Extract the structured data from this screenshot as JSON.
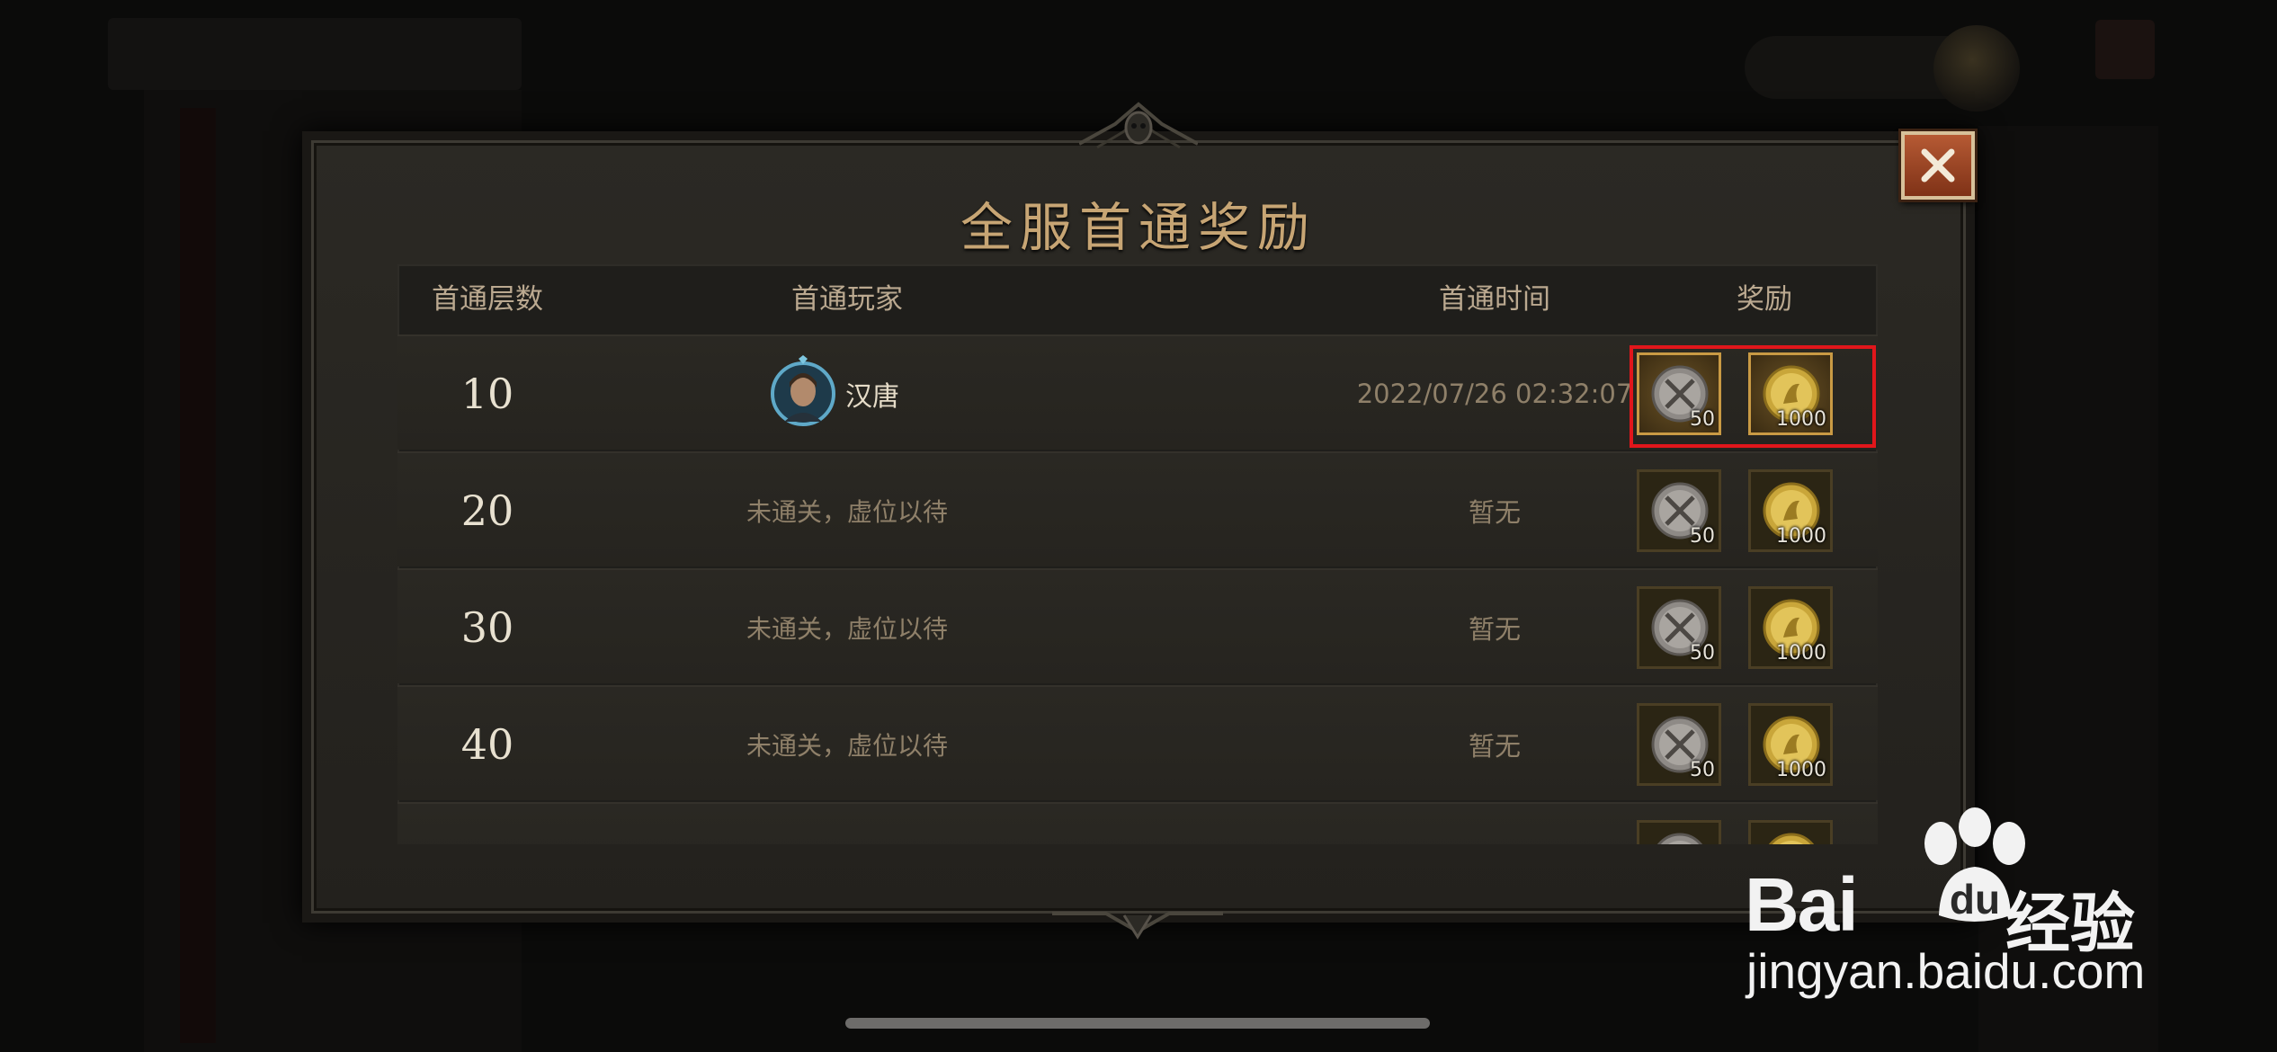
{
  "dialog": {
    "title": "全服首通奖励",
    "close_icon": "close-icon"
  },
  "table": {
    "headers": {
      "floor": "首通层数",
      "player": "首通玩家",
      "time": "首通时间",
      "reward": "奖励"
    },
    "rows": [
      {
        "floor": "10",
        "player": "汉唐",
        "time": "2022/07/26 02:32:07",
        "rewards": [
          {
            "icon": "silver-crossed-swords-coin-icon",
            "qty": "50"
          },
          {
            "icon": "gold-coin-icon",
            "qty": "1000"
          }
        ]
      },
      {
        "floor": "20",
        "player": "未通关，虚位以待",
        "time": "暂无",
        "rewards": [
          {
            "icon": "silver-crossed-swords-coin-icon",
            "qty": "50"
          },
          {
            "icon": "gold-coin-icon",
            "qty": "1000"
          }
        ]
      },
      {
        "floor": "30",
        "player": "未通关，虚位以待",
        "time": "暂无",
        "rewards": [
          {
            "icon": "silver-crossed-swords-coin-icon",
            "qty": "50"
          },
          {
            "icon": "gold-coin-icon",
            "qty": "1000"
          }
        ]
      },
      {
        "floor": "40",
        "player": "未通关，虚位以待",
        "time": "暂无",
        "rewards": [
          {
            "icon": "silver-crossed-swords-coin-icon",
            "qty": "50"
          },
          {
            "icon": "gold-coin-icon",
            "qty": "1000"
          }
        ]
      }
    ]
  },
  "watermark": {
    "brand": "Bai",
    "brand_suffix": "du",
    "product": "经验",
    "url": "jingyan.baidu.com"
  },
  "colors": {
    "title": "#c7a574",
    "highlight": "#e1161b",
    "close_button": "#b65a34"
  }
}
